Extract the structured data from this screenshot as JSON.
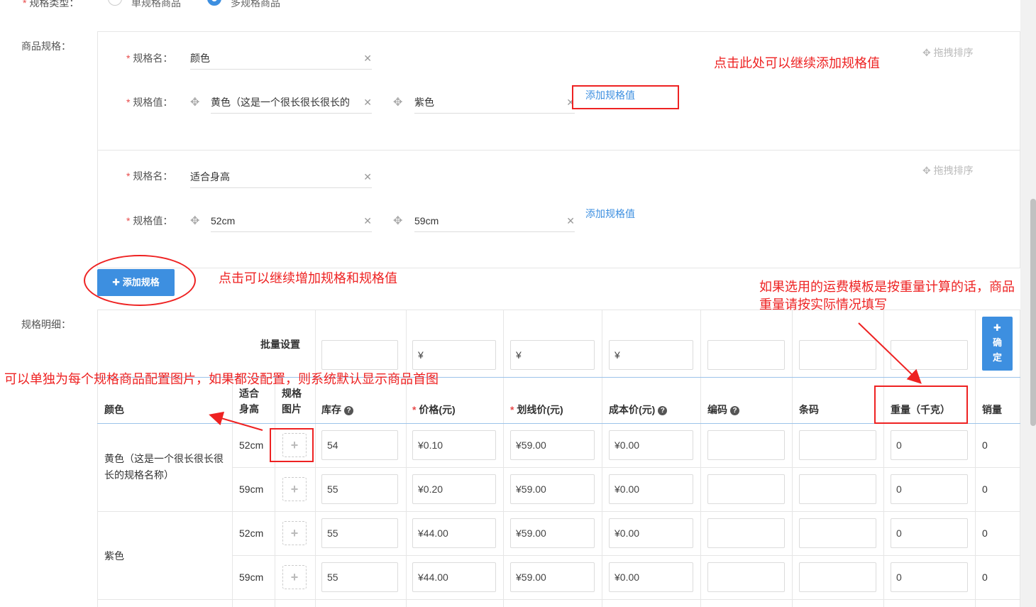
{
  "spec_type": {
    "label": "规格类型：",
    "options": [
      "单规格商品",
      "多规格商品"
    ],
    "selected": "多规格商品"
  },
  "spec_section_label": "商品规格：",
  "specs": [
    {
      "name_label": "规格名：",
      "name_value": "颜色",
      "values_label": "规格值：",
      "values": [
        "黄色（这是一个很长很长很长的",
        "紫色"
      ],
      "add_value_link": "添加规格值",
      "drag_label": "拖拽排序"
    },
    {
      "name_label": "规格名：",
      "name_value": "适合身高",
      "values_label": "规格值：",
      "values": [
        "52cm",
        "59cm"
      ],
      "add_value_link": "添加规格值",
      "drag_label": "拖拽排序"
    }
  ],
  "add_spec_button": "添加规格",
  "detail_label": "规格明细：",
  "batch": {
    "label": "批量设置",
    "price_prefix": "¥",
    "confirm_label": "确定"
  },
  "table": {
    "headers": {
      "color": "颜色",
      "height": "适合身高",
      "image": "规格图片",
      "stock": "库存",
      "price": "价格(元)",
      "list_price": "划线价(元)",
      "cost": "成本价(元)",
      "code": "编码",
      "barcode": "条码",
      "weight": "重量（千克）",
      "sales": "销量"
    },
    "groups": [
      {
        "color": "黄色（这是一个很长很长很长的规格名称）"
      },
      {
        "color": "紫色"
      }
    ],
    "rows": [
      {
        "height": "52cm",
        "stock": "54",
        "price": "¥0.10",
        "list_price": "¥59.00",
        "cost": "¥0.00",
        "weight": "0",
        "sales": "0"
      },
      {
        "height": "59cm",
        "stock": "55",
        "price": "¥0.20",
        "list_price": "¥59.00",
        "cost": "¥0.00",
        "weight": "0",
        "sales": "0"
      },
      {
        "height": "52cm",
        "stock": "55",
        "price": "¥44.00",
        "list_price": "¥59.00",
        "cost": "¥0.00",
        "weight": "0",
        "sales": "0"
      },
      {
        "height": "59cm",
        "stock": "55",
        "price": "¥44.00",
        "list_price": "¥59.00",
        "cost": "¥0.00",
        "weight": "0",
        "sales": "0"
      }
    ]
  },
  "annotations": {
    "add_value": "点击此处可以继续添加规格值",
    "add_spec": "点击可以继续增加规格和规格值",
    "weight_line1": "如果选用的运费模板是按重量计算的话，商品",
    "weight_line2": "重量请按实际情况填写",
    "image": "可以单独为每个规格商品配置图片，如果都没配置，则系统默认显示商品首图"
  },
  "colors": {
    "annotation": "#ee2222",
    "primary": "#3d8fe0",
    "required": "#e84b4b"
  }
}
